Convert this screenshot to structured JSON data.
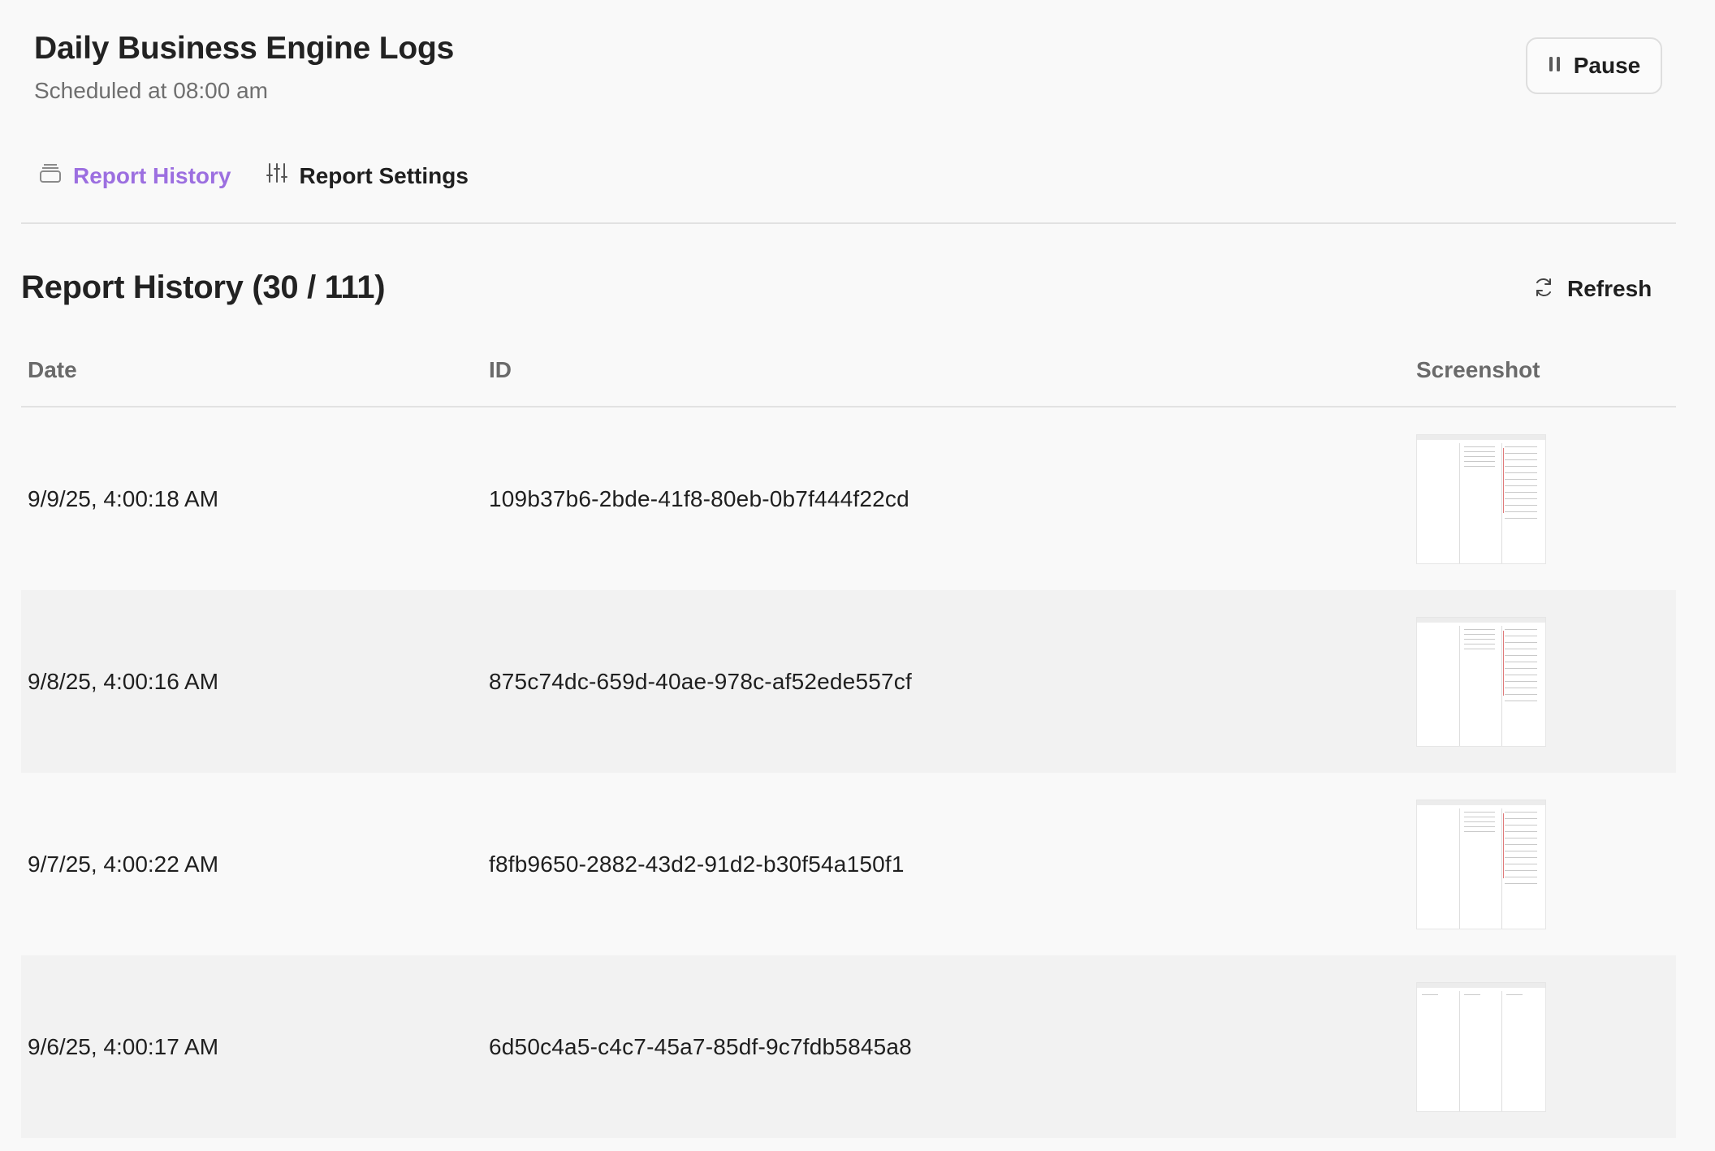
{
  "header": {
    "title": "Daily Business Engine Logs",
    "subtitle": "Scheduled at 08:00 am",
    "pause_label": "Pause"
  },
  "tabs": [
    {
      "label": "Report History",
      "icon": "archive-icon",
      "active": true
    },
    {
      "label": "Report Settings",
      "icon": "sliders-icon",
      "active": false
    }
  ],
  "section": {
    "title": "Report History (30 / 111)",
    "refresh_label": "Refresh"
  },
  "table": {
    "columns": [
      "Date",
      "ID",
      "Screenshot"
    ],
    "rows": [
      {
        "date": "9/9/25, 4:00:18 AM",
        "id": "109b37b6-2bde-41f8-80eb-0b7f444f22cd",
        "screenshot": "report-thumbnail"
      },
      {
        "date": "9/8/25, 4:00:16 AM",
        "id": "875c74dc-659d-40ae-978c-af52ede557cf",
        "screenshot": "report-thumbnail"
      },
      {
        "date": "9/7/25, 4:00:22 AM",
        "id": "f8fb9650-2882-43d2-91d2-b30f54a150f1",
        "screenshot": "report-thumbnail"
      },
      {
        "date": "9/6/25, 4:00:17 AM",
        "id": "6d50c4a5-c4c7-45a7-85df-9c7fdb5845a8",
        "screenshot": "report-thumbnail"
      }
    ]
  },
  "colors": {
    "accent": "#9c6fe0",
    "text": "#1f1f1f",
    "muted": "#6f6f6f",
    "background": "#f9f9f9",
    "row_alt": "#f2f2f2"
  }
}
